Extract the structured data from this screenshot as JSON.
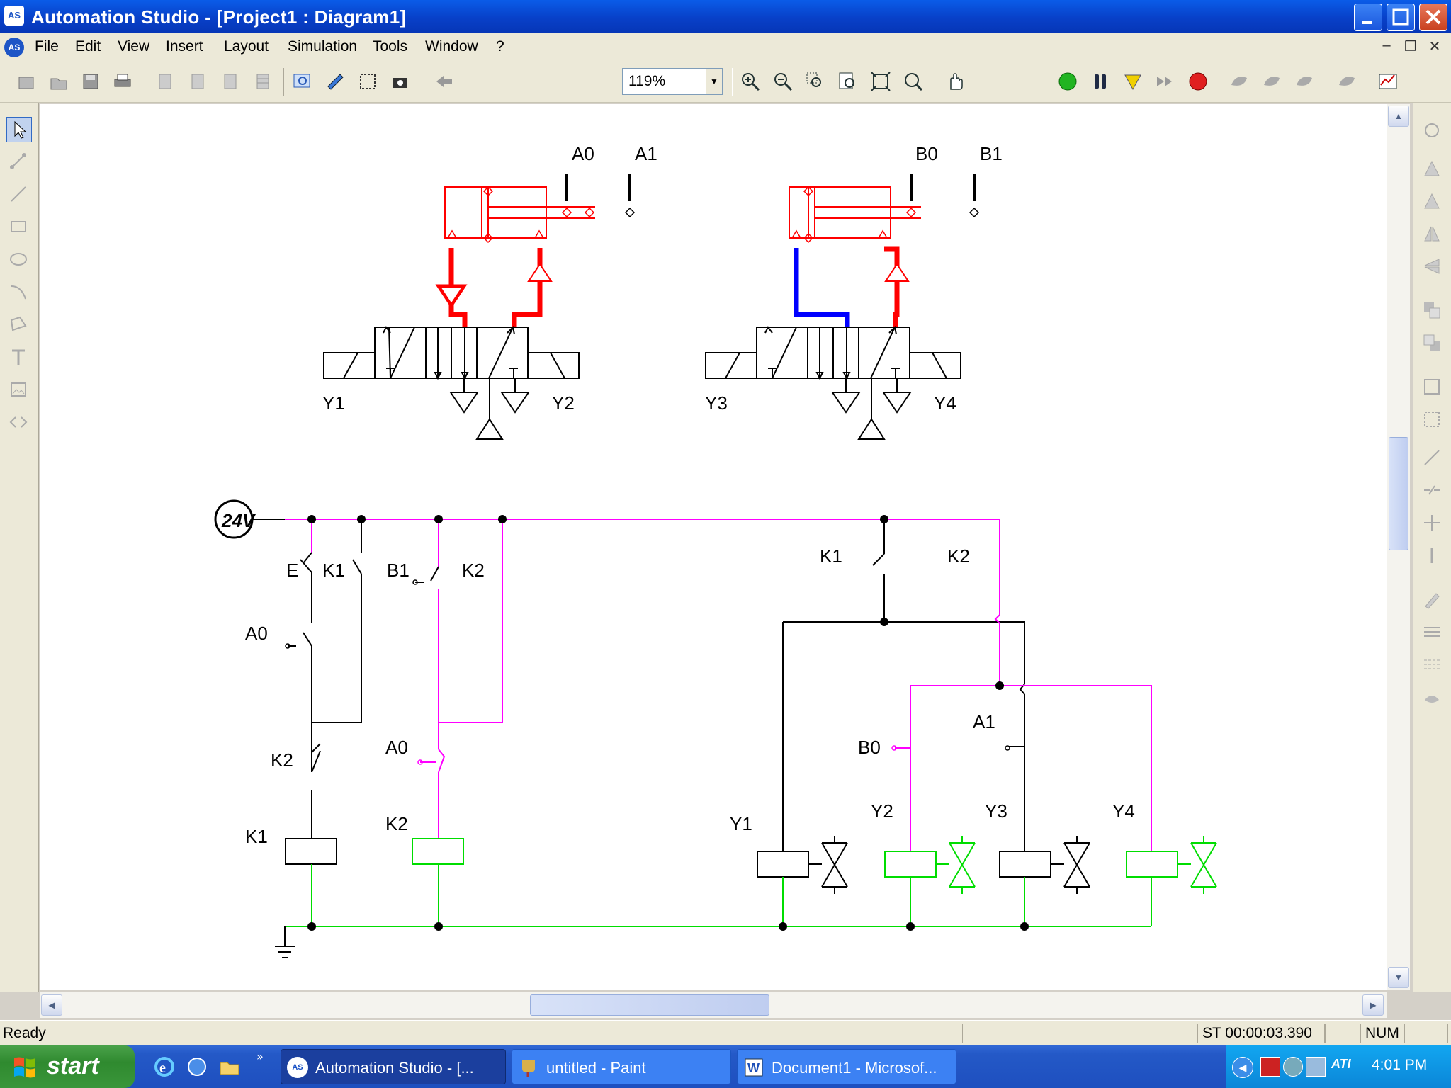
{
  "window": {
    "title": "Automation Studio - [Project1 : Diagram1]",
    "app_icon": "AS"
  },
  "menu": {
    "items": [
      "File",
      "Edit",
      "View",
      "Insert",
      "Layout",
      "Simulation",
      "Tools",
      "Window",
      "?"
    ]
  },
  "toolbar": {
    "zoom": "119%"
  },
  "diagram": {
    "sensors": [
      "A0",
      "A1",
      "B0",
      "B1"
    ],
    "solenoids": [
      "Y1",
      "Y2",
      "Y3",
      "Y4"
    ],
    "supply": "24V",
    "ladder": {
      "ps_label": "E",
      "k1_a": "K1",
      "b1_a": "B1",
      "k2_a": "K2",
      "a0_a": "A0",
      "k2_b": "K2",
      "a0_b": "A0",
      "k1_coil": "K1",
      "k2_coil": "K2",
      "k1_b": "K1",
      "k2_c": "K2",
      "a1": "A1",
      "b0": "B0",
      "y1": "Y1",
      "y2": "Y2",
      "y3": "Y3",
      "y4": "Y4"
    },
    "colors": {
      "pressure": "#ff0000",
      "exhaust": "#0000ff",
      "active": "#ff00ff",
      "ground": "#00dd00",
      "line": "#000000"
    }
  },
  "status": {
    "ready": "Ready",
    "time": "ST 00:00:03.390",
    "num": "NUM"
  },
  "taskbar": {
    "start": "start",
    "tasks": [
      "Automation Studio - [...",
      "untitled - Paint",
      "Document1 - Microsof..."
    ],
    "clock": "4:01 PM"
  }
}
